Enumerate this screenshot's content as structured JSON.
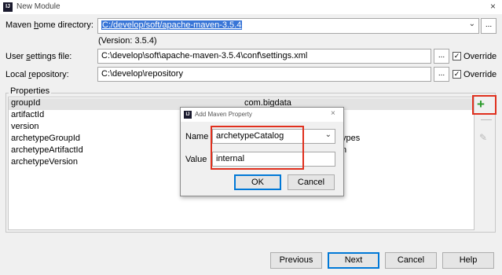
{
  "window": {
    "title": "New Module",
    "close_icon": "×",
    "app_icon": "IJ"
  },
  "form": {
    "maven_home": {
      "label_pre": "Maven ",
      "label_u": "h",
      "label_post": "ome directory:",
      "value": "C:/develop/soft/apache-maven-3.5.4",
      "version": "(Version: 3.5.4)"
    },
    "user_settings": {
      "label_pre": "User ",
      "label_u": "s",
      "label_post": "ettings file:",
      "value": "C:\\develop\\soft\\apache-maven-3.5.4\\conf\\settings.xml",
      "browse": "...",
      "override_label": "Override",
      "override_checked": true
    },
    "local_repo": {
      "label_pre": "Local ",
      "label_u": "r",
      "label_post": "epository:",
      "value": "C:\\develop\\repository",
      "browse": "...",
      "override_label": "Override",
      "override_checked": true
    }
  },
  "properties": {
    "title": "Properties",
    "rows": [
      {
        "key": "groupId",
        "value": "com.bigdata"
      },
      {
        "key": "artifactId",
        "value": ""
      },
      {
        "key": "version",
        "value": ""
      },
      {
        "key": "archetypeGroupId",
        "value": "ypes"
      },
      {
        "key": "archetypeArtifactId",
        "value": "n"
      },
      {
        "key": "archetypeVersion",
        "value": ""
      }
    ]
  },
  "dialog": {
    "title": "Add Maven Property",
    "close_icon": "×",
    "name_label": "Name",
    "name_value": "archetypeCatalog",
    "value_label": "Value",
    "value_value": "internal",
    "ok": "OK",
    "cancel": "Cancel"
  },
  "buttons": {
    "previous": "Previous",
    "next": "Next",
    "cancel": "Cancel",
    "help": "Help"
  },
  "icons": {
    "dropdown": "⌄",
    "plus": "+",
    "minus": "—",
    "edit": "✎",
    "check": "✓"
  },
  "colors": {
    "selection": "#3875d7",
    "highlight_box": "#e0301e",
    "add_icon": "#2a9a2a"
  }
}
